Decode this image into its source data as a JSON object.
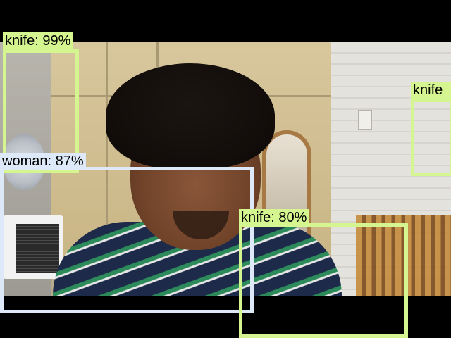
{
  "colors": {
    "knife_box": "#d4f58f",
    "woman_box": "#dde9f8",
    "letterbox": "#000000"
  },
  "detections": [
    {
      "label": "knife: 99%",
      "class": "knife",
      "score": 0.99
    },
    {
      "label": "knife",
      "class": "knife"
    },
    {
      "label": "woman: 87%",
      "class": "woman",
      "score": 0.87
    },
    {
      "label": "knife: 80%",
      "class": "knife",
      "score": 0.8
    }
  ]
}
